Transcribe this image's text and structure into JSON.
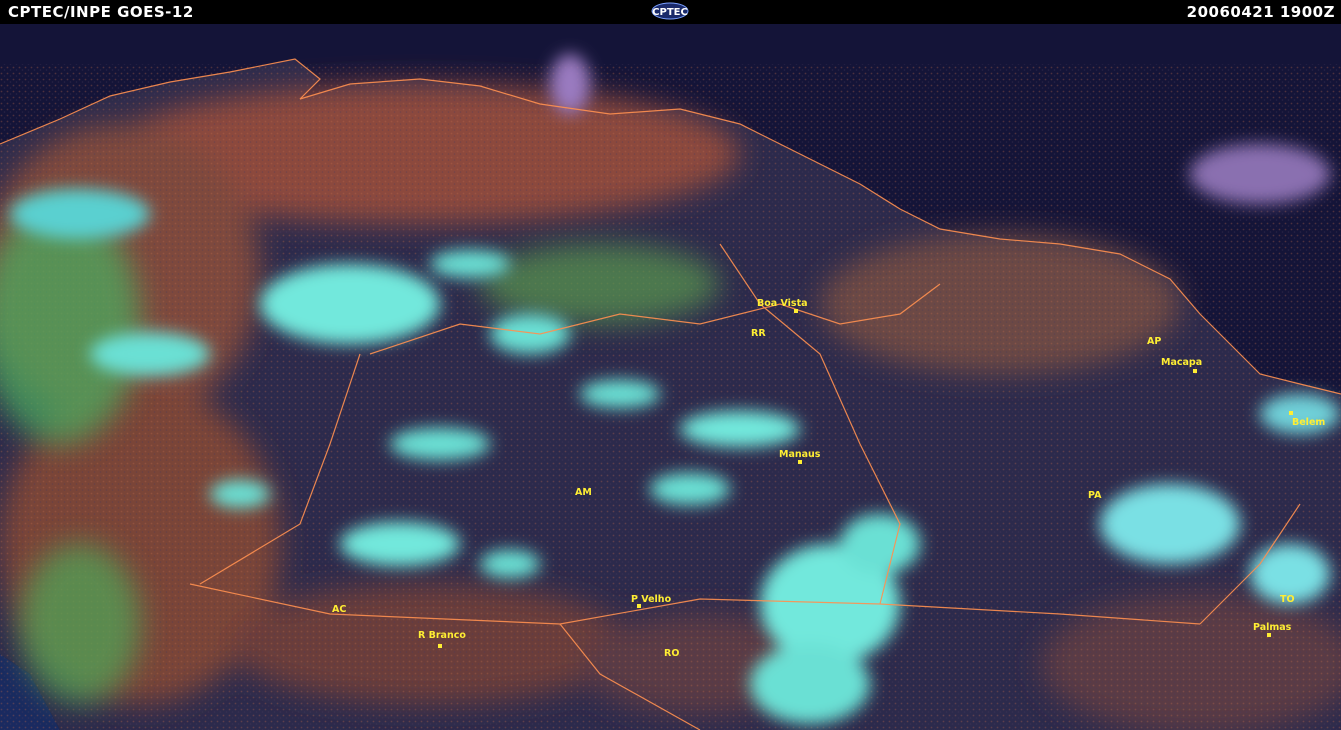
{
  "header": {
    "left_title": "CPTEC/INPE GOES-12",
    "logo_text": "CPTEC",
    "timestamp": "20060421 1900Z"
  },
  "map": {
    "cities": [
      {
        "id": "boa-vista",
        "label": "Boa Vista"
      },
      {
        "id": "macapa",
        "label": "Macapa"
      },
      {
        "id": "belem",
        "label": "Belem"
      },
      {
        "id": "manaus",
        "label": "Manaus"
      },
      {
        "id": "p-velho",
        "label": "P Velho"
      },
      {
        "id": "r-branco",
        "label": "R Branco"
      },
      {
        "id": "palmas",
        "label": "Palmas"
      }
    ],
    "states": [
      {
        "id": "rr",
        "label": "RR"
      },
      {
        "id": "ap",
        "label": "AP"
      },
      {
        "id": "am",
        "label": "AM"
      },
      {
        "id": "pa",
        "label": "PA"
      },
      {
        "id": "ac",
        "label": "AC"
      },
      {
        "id": "ro",
        "label": "RO"
      },
      {
        "id": "to",
        "label": "TO"
      }
    ],
    "colors": {
      "ocean": "#14143a",
      "land": "#8a4a3a",
      "forest": "#2a2a4a",
      "cloud": "#66e6d8",
      "border": "#ff9050",
      "label": "#ffee33"
    }
  }
}
